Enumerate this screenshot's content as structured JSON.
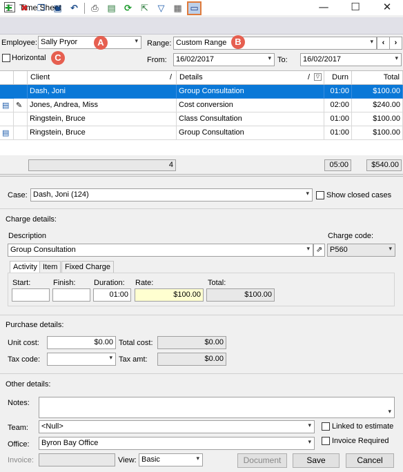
{
  "window": {
    "title": "Time Sheet",
    "minimize": "—",
    "maximize": "☐",
    "close": "✕"
  },
  "toolbar": {
    "icons": [
      "add-icon",
      "delete-icon",
      "copy-icon",
      "save-icon",
      "undo-icon",
      "print-icon",
      "export-icon",
      "refresh-icon",
      "import-icon",
      "filter-icon",
      "grid-icon",
      "split-view-icon"
    ]
  },
  "filters": {
    "employee_label": "Employee:",
    "employee_value": "Sally Pryor",
    "range_label": "Range:",
    "range_value": "Custom Range",
    "from_label": "From:",
    "from_value": "16/02/2017",
    "to_label": "To:",
    "to_value": "16/02/2017",
    "horizontal_label": "Horizontal",
    "prev": "‹",
    "next": "›"
  },
  "callouts": {
    "a": "A",
    "b": "B",
    "c": "C"
  },
  "grid": {
    "headers": {
      "client": "Client",
      "details": "Details",
      "durn": "Durn",
      "total": "Total",
      "sort": "/"
    },
    "rows": [
      {
        "client": "Dash, Joni",
        "details": "Group Consultation",
        "durn": "01:00",
        "total": "$100.00"
      },
      {
        "client": "Jones, Andrea, Miss",
        "details": "Cost conversion",
        "durn": "02:00",
        "total": "$240.00"
      },
      {
        "client": "Ringstein, Bruce",
        "details": "Class Consultation",
        "durn": "01:00",
        "total": "$100.00"
      },
      {
        "client": "Ringstein, Bruce",
        "details": "Group Consultation",
        "durn": "01:00",
        "total": "$100.00"
      }
    ],
    "summary": {
      "count": "4",
      "durn": "05:00",
      "total": "$540.00"
    }
  },
  "case": {
    "label": "Case:",
    "value": "Dash, Joni (124)",
    "show_closed": "Show closed cases"
  },
  "charge": {
    "section": "Charge details:",
    "description_label": "Description",
    "description_value": "Group Consultation",
    "code_label": "Charge code:",
    "code_value": "P560",
    "tabs": [
      "Activity",
      "Item",
      "Fixed Charge"
    ],
    "start_label": "Start:",
    "finish_label": "Finish:",
    "duration_label": "Duration:",
    "rate_label": "Rate:",
    "total_label": "Total:",
    "start_value": "",
    "finish_value": "",
    "duration_value": "01:00",
    "rate_value": "$100.00",
    "total_value": "$100.00"
  },
  "purchase": {
    "section": "Purchase details:",
    "unit_cost_label": "Unit cost:",
    "unit_cost_value": "$0.00",
    "total_cost_label": "Total cost:",
    "total_cost_value": "$0.00",
    "tax_code_label": "Tax code:",
    "tax_code_value": "",
    "tax_amt_label": "Tax amt:",
    "tax_amt_value": "$0.00"
  },
  "other": {
    "section": "Other details:",
    "notes_label": "Notes:",
    "notes_value": "",
    "team_label": "Team:",
    "team_value": "<Null>",
    "linked_label": "Linked to estimate",
    "office_label": "Office:",
    "office_value": "Byron Bay Office",
    "invoice_required_label": "Invoice Required",
    "invoice_label": "Invoice:",
    "invoice_value": "",
    "view_label": "View:",
    "view_value": "Basic"
  },
  "buttons": {
    "document": "Document",
    "save": "Save",
    "cancel": "Cancel"
  }
}
